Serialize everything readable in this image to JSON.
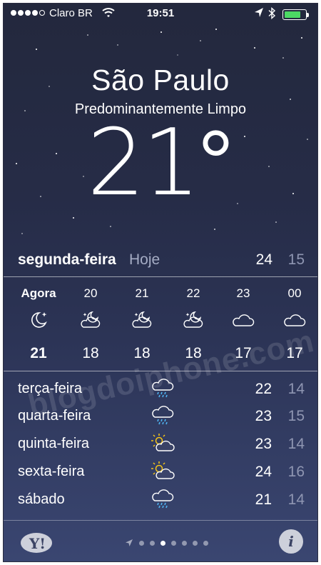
{
  "status_bar": {
    "carrier": "Claro BR",
    "time": "19:51",
    "battery_level": 0.8,
    "signal_bars": 4,
    "icons": [
      "wifi-icon",
      "location-arrow-icon",
      "bluetooth-icon",
      "battery-icon"
    ]
  },
  "location": {
    "city": "São Paulo",
    "condition": "Predominantemente Limpo",
    "temperature": "21",
    "degree": "°"
  },
  "today": {
    "day": "segunda-feira",
    "relative": "Hoje",
    "high": "24",
    "low": "15"
  },
  "hourly": [
    {
      "hour": "Agora",
      "icon": "moon-stars-icon",
      "temp": "21"
    },
    {
      "hour": "20",
      "icon": "partly-cloudy-night-icon",
      "temp": "18"
    },
    {
      "hour": "21",
      "icon": "partly-cloudy-night-icon",
      "temp": "18"
    },
    {
      "hour": "22",
      "icon": "partly-cloudy-night-icon",
      "temp": "18"
    },
    {
      "hour": "23",
      "icon": "cloud-icon",
      "temp": "17"
    },
    {
      "hour": "00",
      "icon": "cloud-icon",
      "temp": "17"
    }
  ],
  "daily": [
    {
      "day": "terça-feira",
      "icon": "rain-cloud-icon",
      "high": "22",
      "low": "14"
    },
    {
      "day": "quarta-feira",
      "icon": "rain-cloud-icon",
      "high": "23",
      "low": "15"
    },
    {
      "day": "quinta-feira",
      "icon": "sun-cloud-icon",
      "high": "23",
      "low": "14"
    },
    {
      "day": "sexta-feira",
      "icon": "sun-cloud-icon",
      "high": "24",
      "low": "16"
    },
    {
      "day": "sábado",
      "icon": "rain-cloud-icon",
      "high": "21",
      "low": "14"
    }
  ],
  "watermark": "blogdoiphone.com",
  "bottom_bar": {
    "yahoo_logo_text": "Y!",
    "info_label": "i",
    "page_count": 8,
    "active_page": 3
  },
  "colors": {
    "background_top": "#23283d",
    "background_bottom": "#3a4671",
    "low_temp": "#8f96b2",
    "battery": "#4cd964",
    "sun": "#f5c518",
    "rain": "#4fb3f0"
  }
}
